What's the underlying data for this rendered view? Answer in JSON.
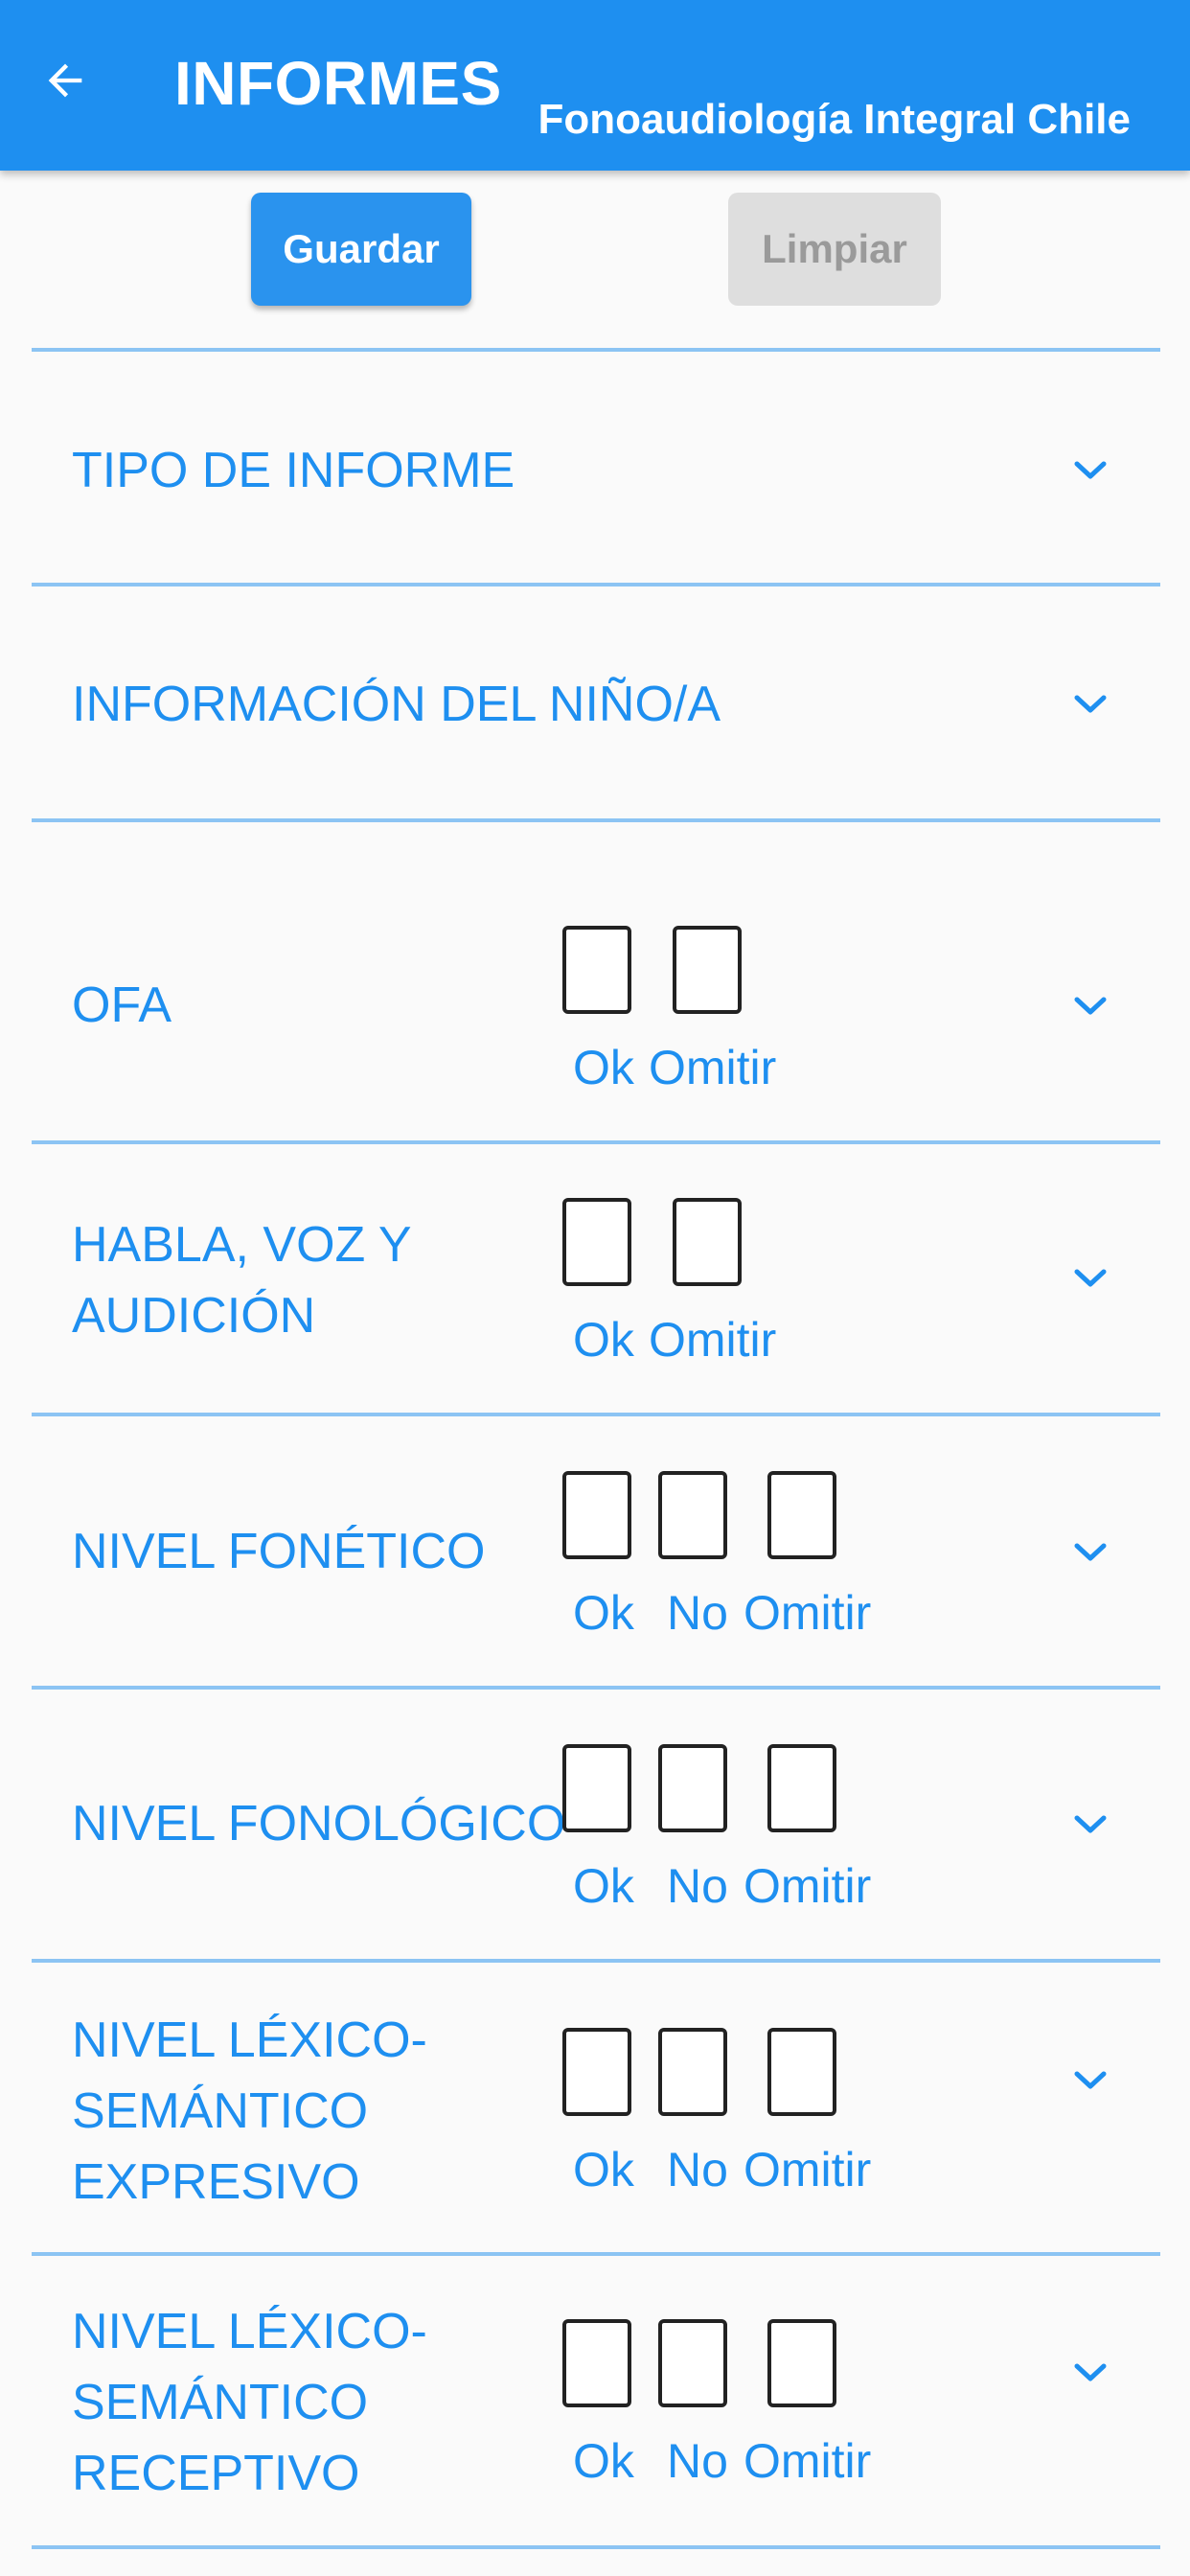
{
  "appbar": {
    "title": "INFORMES",
    "subtitle": "Fonoaudiología Integral Chile",
    "back_icon": "arrow-left-icon"
  },
  "actions": {
    "save_label": "Guardar",
    "clear_label": "Limpiar"
  },
  "sections": [
    {
      "title": "TIPO DE INFORME"
    },
    {
      "title": "INFORMACIÓN DEL NIÑO/A"
    }
  ],
  "items": [
    {
      "title": [
        "OFA"
      ],
      "options": [
        "Ok",
        "Omitir"
      ]
    },
    {
      "title": [
        "HABLA, VOZ Y",
        "AUDICIÓN"
      ],
      "options": [
        "Ok",
        "Omitir"
      ]
    },
    {
      "title": [
        "NIVEL FONÉTICO"
      ],
      "options": [
        "Ok",
        "No",
        "Omitir"
      ]
    },
    {
      "title": [
        "NIVEL FONOLÓGICO"
      ],
      "options": [
        "Ok",
        "No",
        "Omitir"
      ]
    },
    {
      "title": [
        "NIVEL LÉXICO-",
        "SEMÁNTICO",
        "EXPRESIVO"
      ],
      "options": [
        "Ok",
        "No",
        "Omitir"
      ]
    },
    {
      "title": [
        "NIVEL LÉXICO-",
        "SEMÁNTICO",
        "RECEPTIVO"
      ],
      "options": [
        "Ok",
        "No",
        "Omitir"
      ]
    }
  ],
  "colors": {
    "primary": "#1e8ff0",
    "divider": "#8cc4f3",
    "clear_bg": "#dedede",
    "clear_text": "#9a9a9a"
  }
}
